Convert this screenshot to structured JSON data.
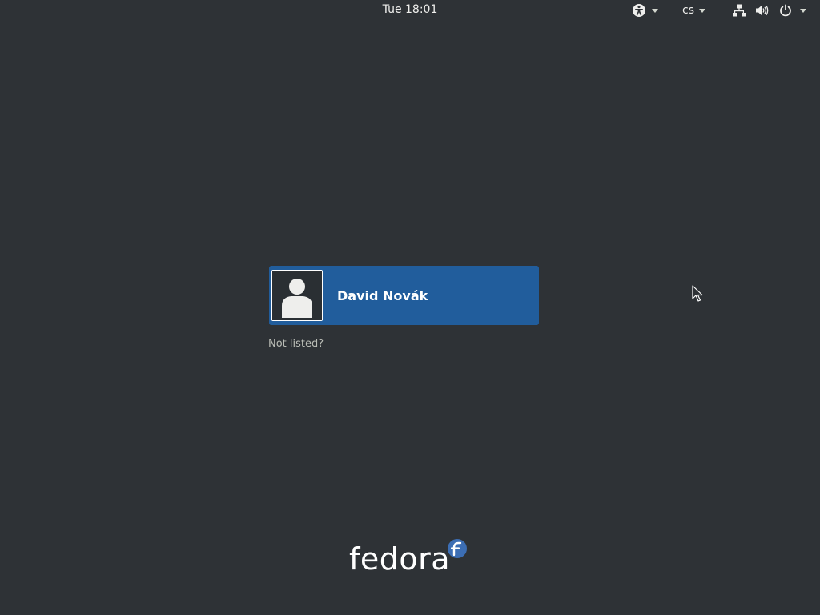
{
  "topbar": {
    "clock": "Tue 18:01",
    "accessibility_icon": "accessibility-icon",
    "keyboard_layout": "cs",
    "network_icon": "network-wired-icon",
    "volume_icon": "volume-icon",
    "power_icon": "power-icon"
  },
  "login": {
    "users": [
      {
        "name": "David Novák",
        "avatar_icon": "user-avatar-icon"
      }
    ],
    "not_listed_label": "Not listed?"
  },
  "branding": {
    "logo_text": "fedora",
    "logo_icon": "fedora-badge-icon"
  },
  "colors": {
    "background": "#2e3236",
    "user_card": "#215d9c",
    "text": "#eeeeec",
    "muted_text": "#babdb6",
    "fedora_blue": "#3c6eb4"
  }
}
